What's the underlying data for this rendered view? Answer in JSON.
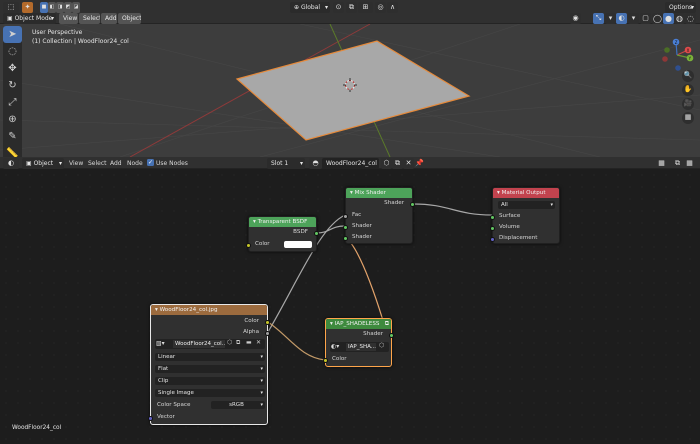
{
  "viewport": {
    "header": {
      "mode": "Object Mode",
      "menus": [
        "View",
        "Select",
        "Add",
        "Object"
      ],
      "transform_orientation": "Global",
      "options": "Options"
    },
    "overlay_lines": [
      "User Perspective",
      "(1) Collection | WoodFloor24_col"
    ],
    "gizmo_axes": {
      "x": "X",
      "y": "Y",
      "z": "Z"
    },
    "colors": {
      "background": "#3d3d3d",
      "plane": "#a8a8a8",
      "outline": "#e58a3b",
      "x_axis": "#8f3a3a",
      "y_axis": "#5b7a2a"
    }
  },
  "node_editor": {
    "header": {
      "editor_type_icon": "shader-editor-icon",
      "object_dropdown": "Object",
      "menus": [
        "View",
        "Select",
        "Add",
        "Node"
      ],
      "use_nodes_label": "Use Nodes",
      "use_nodes_checked": true,
      "slot": "Slot 1",
      "material_name": "WoodFloor24_col"
    },
    "footer_label": "WoodFloor24_col",
    "nodes": {
      "mix_shader": {
        "title": "Mix Shader",
        "output": "Shader",
        "inputs": [
          "Fac",
          "Shader",
          "Shader"
        ],
        "header_color": "#4da35a"
      },
      "material_output": {
        "title": "Material Output",
        "target": "All",
        "inputs": [
          "Surface",
          "Volume",
          "Displacement"
        ],
        "header_color": "#c2434e"
      },
      "transparent_bsdf": {
        "title": "Transparent BSDF",
        "output": "BSDF",
        "input": "Color",
        "color_value": "#ffffff",
        "header_color": "#4da35a"
      },
      "image_texture": {
        "title": "WoodFloor24_col.jpg",
        "outputs": [
          "Color",
          "Alpha"
        ],
        "image_name": "WoodFloor24_col...",
        "interpolation": "Linear",
        "projection": "Flat",
        "extension": "Clip",
        "source": "Single Image",
        "color_space_label": "Color Space",
        "color_space": "sRGB",
        "input": "Vector",
        "header_color": "#9c6b3e"
      },
      "iap_shadeless": {
        "title": "IAP_SHADELESS",
        "output": "Shader",
        "group_name": "IAP_SHA...",
        "input": "Color",
        "header_color": "#3e8a3e"
      }
    }
  }
}
